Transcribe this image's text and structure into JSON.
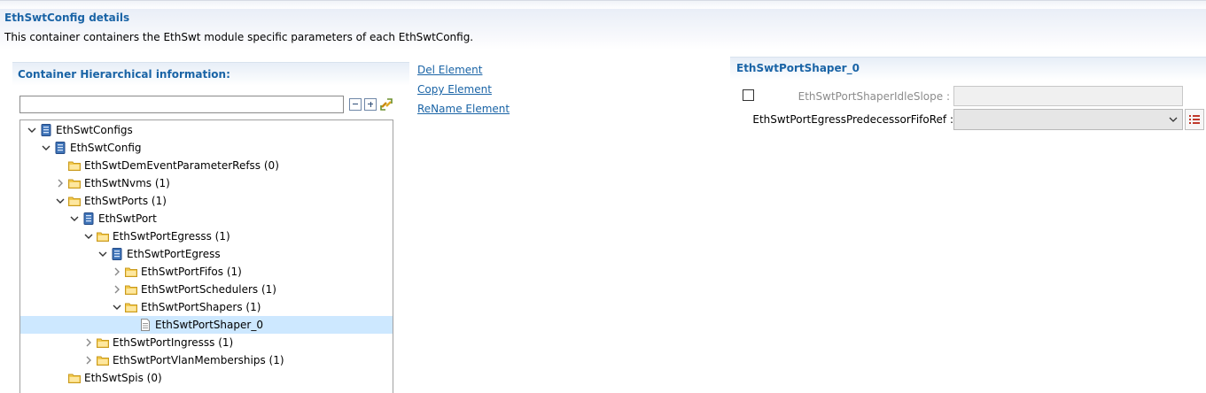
{
  "header": {
    "title": "EthSwtConfig details",
    "description": "This container containers the EthSwt module specific parameters of each EthSwtConfig."
  },
  "left_panel": {
    "title": "Container Hierarchical information:",
    "filter_value": "",
    "toolbar": {
      "collapse_icon": "collapse-all-icon",
      "expand_icon": "expand-all-icon",
      "link_icon": "link-with-editor-icon"
    }
  },
  "tree": {
    "items": [
      {
        "label": "EthSwtConfigs",
        "depth": 0,
        "chevron": "expanded",
        "icon": "module-icon"
      },
      {
        "label": "EthSwtConfig",
        "depth": 1,
        "chevron": "expanded",
        "icon": "module-icon"
      },
      {
        "label": "EthSwtDemEventParameterRefss (0)",
        "depth": 2,
        "chevron": "none",
        "icon": "folder-icon"
      },
      {
        "label": "EthSwtNvms (1)",
        "depth": 2,
        "chevron": "collapsed",
        "icon": "folder-icon"
      },
      {
        "label": "EthSwtPorts (1)",
        "depth": 2,
        "chevron": "expanded",
        "icon": "folder-icon"
      },
      {
        "label": "EthSwtPort",
        "depth": 3,
        "chevron": "expanded",
        "icon": "module-icon"
      },
      {
        "label": "EthSwtPortEgresss (1)",
        "depth": 4,
        "chevron": "expanded",
        "icon": "folder-icon"
      },
      {
        "label": "EthSwtPortEgress",
        "depth": 5,
        "chevron": "expanded",
        "icon": "module-icon"
      },
      {
        "label": "EthSwtPortFifos (1)",
        "depth": 6,
        "chevron": "collapsed",
        "icon": "folder-icon"
      },
      {
        "label": "EthSwtPortSchedulers (1)",
        "depth": 6,
        "chevron": "collapsed",
        "icon": "folder-icon"
      },
      {
        "label": "EthSwtPortShapers (1)",
        "depth": 6,
        "chevron": "expanded",
        "icon": "folder-icon"
      },
      {
        "label": "EthSwtPortShaper_0",
        "depth": 7,
        "chevron": "none",
        "icon": "document-icon",
        "selected": true
      },
      {
        "label": "EthSwtPortIngresss (1)",
        "depth": 4,
        "chevron": "collapsed",
        "icon": "folder-icon"
      },
      {
        "label": "EthSwtPortVlanMemberships (1)",
        "depth": 4,
        "chevron": "collapsed",
        "icon": "folder-icon"
      },
      {
        "label": "EthSwtSpis (0)",
        "depth": 2,
        "chevron": "none",
        "icon": "folder-icon"
      }
    ]
  },
  "actions": {
    "del": "Del Element",
    "copy": "Copy Element",
    "rename": "ReName Element"
  },
  "right_panel": {
    "title": "EthSwtPortShaper_0",
    "idle_slope_label": "EthSwtPortShaperIdleSlope :",
    "idle_slope_value": "",
    "idle_slope_checked": false,
    "fifo_ref_label": "EthSwtPortEgressPredecessorFifoRef :",
    "fifo_ref_value": ""
  },
  "colors": {
    "title_blue": "#1a64a6",
    "selection": "#cde8ff",
    "folder": "#f2c94c",
    "module": "#3f74b8"
  }
}
